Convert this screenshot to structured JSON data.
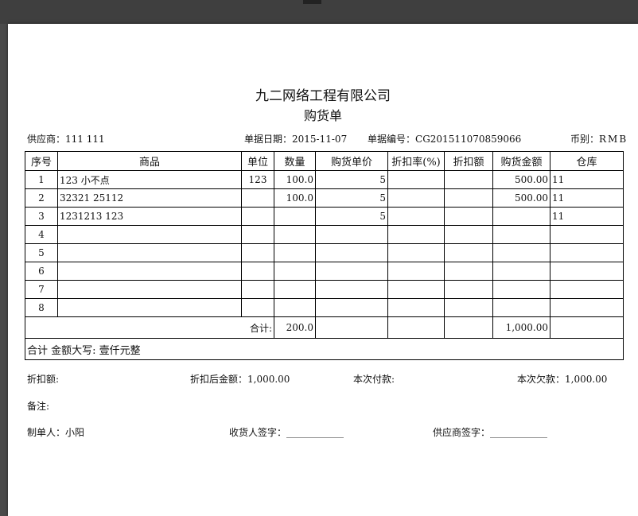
{
  "header": {
    "company": "九二网络工程有限公司",
    "doc_title": "购货单"
  },
  "meta": {
    "supplier_label": "供应商：",
    "supplier_value": "111 111",
    "date_label": "单据日期：",
    "date_value": "2015-11-07",
    "number_label": "单据编号：",
    "number_value": "CG201511070859066",
    "currency_label": "币别：",
    "currency_value": "RMB"
  },
  "table": {
    "columns": [
      "序号",
      "商品",
      "单位",
      "数量",
      "购货单价",
      "折扣率(%)",
      "折扣额",
      "购货金额",
      "仓库"
    ],
    "rows": [
      [
        "1",
        "123 小不点",
        "123",
        "100.0",
        "5",
        "",
        "",
        "500.00",
        "11"
      ],
      [
        "2",
        "32321 25112",
        "",
        "100.0",
        "5",
        "",
        "",
        "500.00",
        "11"
      ],
      [
        "3",
        "1231213 123",
        "",
        "",
        "5",
        "",
        "",
        "",
        "11"
      ],
      [
        "4",
        "",
        "",
        "",
        "",
        "",
        "",
        "",
        ""
      ],
      [
        "5",
        "",
        "",
        "",
        "",
        "",
        "",
        "",
        ""
      ],
      [
        "6",
        "",
        "",
        "",
        "",
        "",
        "",
        "",
        ""
      ],
      [
        "7",
        "",
        "",
        "",
        "",
        "",
        "",
        "",
        ""
      ],
      [
        "8",
        "",
        "",
        "",
        "",
        "",
        "",
        "",
        ""
      ]
    ],
    "total_label": "合计:",
    "total_qty": "200.0",
    "total_amount": "1,000.00",
    "caps_label": "合计 金额大写:",
    "caps_value": "壹仟元整"
  },
  "footer": {
    "discount_label": "折扣额:",
    "after_discount": "折扣后金额：1,000.00",
    "paid": "本次付款:",
    "owed": "本次欠款：1,000.00",
    "remarks": "备注:",
    "maker": "制单人：小阳",
    "receiver_sign": "收货人签字：____________",
    "supplier_sign": "供应商签字：____________"
  }
}
